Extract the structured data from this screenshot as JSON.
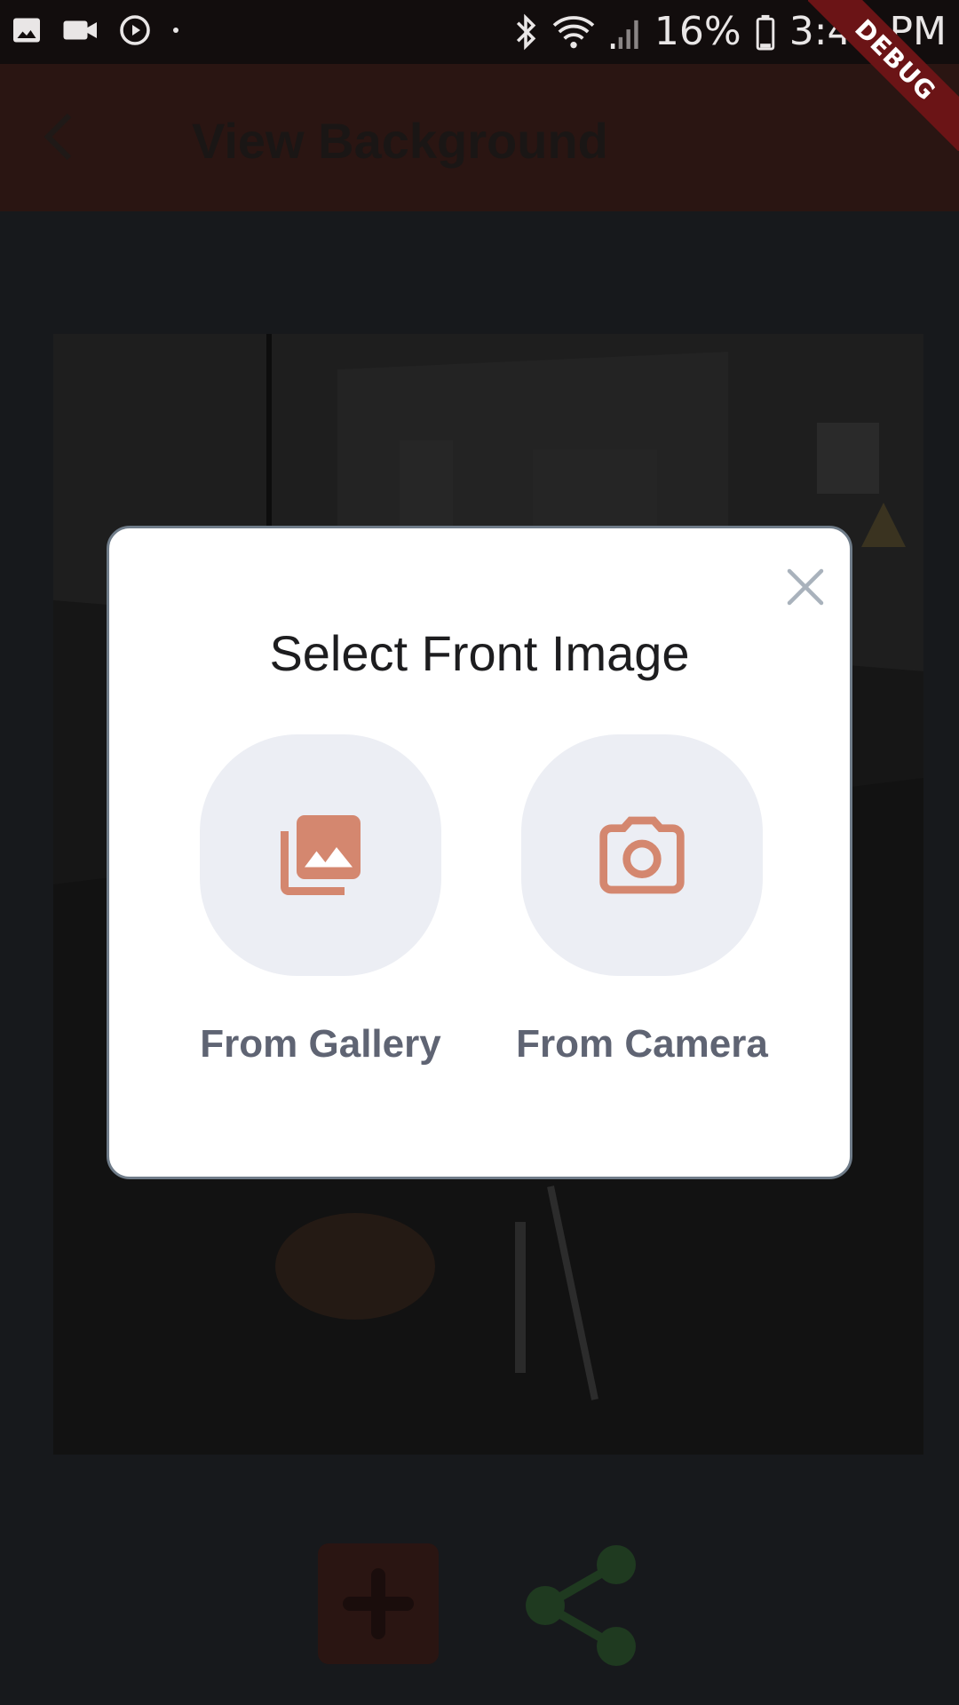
{
  "status_bar": {
    "battery": "16%",
    "time": "3:44 PM",
    "icons": [
      "image-icon",
      "video-camera-icon",
      "play-circle-icon",
      "dot-icon",
      "bluetooth-icon",
      "wifi-icon",
      "signal-icon",
      "battery-icon"
    ]
  },
  "app_bar": {
    "title": "View Background",
    "back_icon": "chevron-left-icon"
  },
  "debug_banner": {
    "label": "DEBUG"
  },
  "dialog": {
    "title": "Select Front Image",
    "close_icon": "close-icon",
    "options": [
      {
        "label": "From Gallery",
        "icon": "photo-library-icon"
      },
      {
        "label": "From Camera",
        "icon": "camera-icon"
      }
    ]
  },
  "bottom_actions": {
    "add_icon": "plus-icon",
    "share_icon": "share-icon"
  },
  "colors": {
    "accent": "#d4876f",
    "tile": "#eceef4",
    "label": "#5f6473",
    "share": "#1f3a20",
    "app_bar": "#2a1512"
  }
}
